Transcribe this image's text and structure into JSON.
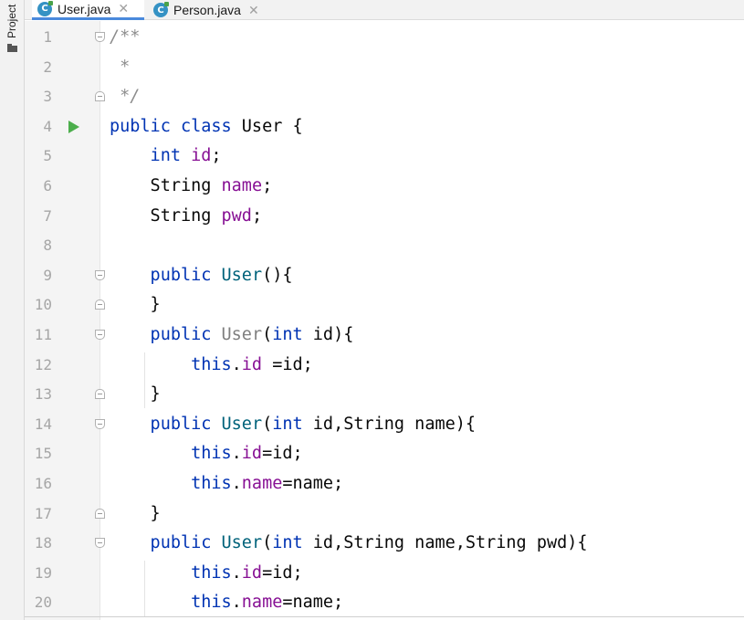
{
  "sidebar": {
    "project_label": "Project",
    "icon": "folder-icon"
  },
  "tabs": [
    {
      "label": "User.java",
      "icon": "java-class-icon",
      "active": true
    },
    {
      "label": "Person.java",
      "icon": "java-class-icon",
      "active": false
    }
  ],
  "editor": {
    "lines": [
      {
        "number": "1",
        "fold": "open",
        "tokens": [
          {
            "t": "/**",
            "c": "cmt"
          }
        ]
      },
      {
        "number": "2",
        "tokens": [
          {
            "t": " *",
            "c": "cmt"
          }
        ]
      },
      {
        "number": "3",
        "fold": "close",
        "tokens": [
          {
            "t": " */",
            "c": "cmt"
          }
        ]
      },
      {
        "number": "4",
        "run": true,
        "tokens": [
          {
            "t": "public class ",
            "c": "kw"
          },
          {
            "t": "User {",
            "c": "plain"
          }
        ]
      },
      {
        "number": "5",
        "tokens": [
          {
            "t": "    int ",
            "c": "kw"
          },
          {
            "t": "id",
            "c": "fld"
          },
          {
            "t": ";",
            "c": "plain"
          }
        ]
      },
      {
        "number": "6",
        "tokens": [
          {
            "t": "    String ",
            "c": "plain"
          },
          {
            "t": "name",
            "c": "fld"
          },
          {
            "t": ";",
            "c": "plain"
          }
        ]
      },
      {
        "number": "7",
        "tokens": [
          {
            "t": "    String ",
            "c": "plain"
          },
          {
            "t": "pwd",
            "c": "fld"
          },
          {
            "t": ";",
            "c": "plain"
          }
        ]
      },
      {
        "number": "8",
        "tokens": []
      },
      {
        "number": "9",
        "fold": "open",
        "tokens": [
          {
            "t": "    public ",
            "c": "kw"
          },
          {
            "t": "User",
            "c": "mth"
          },
          {
            "t": "(){",
            "c": "plain"
          }
        ]
      },
      {
        "number": "10",
        "fold": "close",
        "tokens": [
          {
            "t": "    }",
            "c": "plain"
          }
        ]
      },
      {
        "number": "11",
        "fold": "open",
        "tokens": [
          {
            "t": "    public ",
            "c": "kw"
          },
          {
            "t": "User",
            "c": "unused"
          },
          {
            "t": "(",
            "c": "plain"
          },
          {
            "t": "int ",
            "c": "kw"
          },
          {
            "t": "id){",
            "c": "plain"
          }
        ]
      },
      {
        "number": "12",
        "tokens": [
          {
            "t": "        this",
            "c": "kw"
          },
          {
            "t": ".",
            "c": "plain"
          },
          {
            "t": "id",
            "c": "fld"
          },
          {
            "t": " =id;",
            "c": "plain"
          }
        ]
      },
      {
        "number": "13",
        "fold": "close",
        "tokens": [
          {
            "t": "    }",
            "c": "plain"
          }
        ]
      },
      {
        "number": "14",
        "fold": "open",
        "tokens": [
          {
            "t": "    public ",
            "c": "kw"
          },
          {
            "t": "User",
            "c": "mth"
          },
          {
            "t": "(",
            "c": "plain"
          },
          {
            "t": "int ",
            "c": "kw"
          },
          {
            "t": "id,String name){",
            "c": "plain"
          }
        ]
      },
      {
        "number": "15",
        "tokens": [
          {
            "t": "        this",
            "c": "kw"
          },
          {
            "t": ".",
            "c": "plain"
          },
          {
            "t": "id",
            "c": "fld"
          },
          {
            "t": "=id;",
            "c": "plain"
          }
        ]
      },
      {
        "number": "16",
        "tokens": [
          {
            "t": "        this",
            "c": "kw"
          },
          {
            "t": ".",
            "c": "plain"
          },
          {
            "t": "name",
            "c": "fld"
          },
          {
            "t": "=name;",
            "c": "plain"
          }
        ]
      },
      {
        "number": "17",
        "fold": "close",
        "tokens": [
          {
            "t": "    }",
            "c": "plain"
          }
        ]
      },
      {
        "number": "18",
        "fold": "open",
        "tokens": [
          {
            "t": "    public ",
            "c": "kw"
          },
          {
            "t": "User",
            "c": "mth"
          },
          {
            "t": "(",
            "c": "plain"
          },
          {
            "t": "int ",
            "c": "kw"
          },
          {
            "t": "id,String name,String pwd){",
            "c": "plain"
          }
        ]
      },
      {
        "number": "19",
        "tokens": [
          {
            "t": "        this",
            "c": "kw"
          },
          {
            "t": ".",
            "c": "plain"
          },
          {
            "t": "id",
            "c": "fld"
          },
          {
            "t": "=id;",
            "c": "plain"
          }
        ]
      },
      {
        "number": "20",
        "tokens": [
          {
            "t": "        this",
            "c": "kw"
          },
          {
            "t": ".",
            "c": "plain"
          },
          {
            "t": "name",
            "c": "fld"
          },
          {
            "t": "=name;",
            "c": "plain"
          }
        ]
      }
    ]
  },
  "colors": {
    "keyword": "#0033b3",
    "field": "#871094",
    "method": "#00627a",
    "unused": "#7f7f7f",
    "comment": "#8c8c8c",
    "run": "#4cae4c",
    "tab_underline": "#4a89dc"
  }
}
